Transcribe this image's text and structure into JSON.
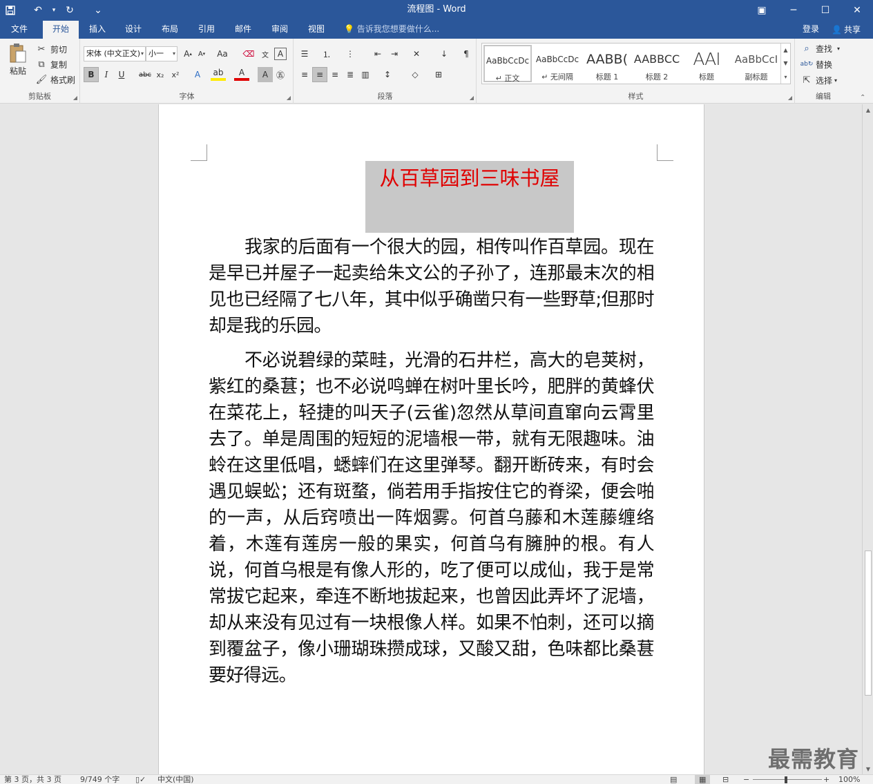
{
  "window": {
    "title": "流程图 - Word",
    "quick_access": {
      "more": "⌄"
    },
    "controls": {
      "ribbon_options": "▣",
      "minimize": "─",
      "maximize": "☐",
      "close": "✕"
    }
  },
  "tabs": [
    {
      "label": "文件",
      "active": false
    },
    {
      "label": "开始",
      "active": true
    },
    {
      "label": "插入",
      "active": false
    },
    {
      "label": "设计",
      "active": false
    },
    {
      "label": "布局",
      "active": false
    },
    {
      "label": "引用",
      "active": false
    },
    {
      "label": "邮件",
      "active": false
    },
    {
      "label": "审阅",
      "active": false
    },
    {
      "label": "视图",
      "active": false
    }
  ],
  "tell_me": "告诉我您想要做什么...",
  "account": {
    "login": "登录",
    "share": "共享"
  },
  "ribbon": {
    "clipboard": {
      "label": "剪贴板",
      "paste": "粘贴",
      "cut": "剪切",
      "copy": "复制",
      "format_painter": "格式刷"
    },
    "font": {
      "label": "字体",
      "font_name": "宋体 (中文正文)",
      "font_size": "小一"
    },
    "paragraph": {
      "label": "段落"
    },
    "styles": {
      "label": "样式",
      "items": [
        {
          "sample": "AaBbCcDc",
          "name": "↵ 正文"
        },
        {
          "sample": "AaBbCcDc",
          "name": "↵ 无间隔"
        },
        {
          "sample": "AABB(",
          "name": "标题 1"
        },
        {
          "sample": "AABBCC",
          "name": "标题 2"
        },
        {
          "sample": "AAI",
          "name": "标题"
        },
        {
          "sample": "AaBbCcI",
          "name": "副标题"
        }
      ]
    },
    "editing": {
      "label": "编辑",
      "find": "查找",
      "replace": "替换",
      "select": "选择"
    }
  },
  "document": {
    "title": "从百草园到三味书屋",
    "paragraphs": [
      "我家的后面有一个很大的园，相传叫作百草园。现在是早已并屋子一起卖给朱文公的子孙了，连那最末次的相见也已经隔了七八年，其中似乎确凿只有一些野草;但那时却是我的乐园。",
      "不必说碧绿的菜畦，光滑的石井栏，高大的皂荚树，紫红的桑葚；也不必说鸣蝉在树叶里长吟，肥胖的黄蜂伏在菜花上，轻捷的叫天子(云雀)忽然从草间直窜向云霄里去了。单是周围的短短的泥墙根一带，就有无限趣味。油蛉在这里低唱，蟋蟀们在这里弹琴。翻开断砖来，有时会遇见蜈蚣；还有斑蝥，倘若用手指按住它的脊梁，便会啪的一声，从后窍喷出一阵烟雾。何首乌藤和木莲藤缠络着，木莲有莲房一般的果实，何首乌有臃肿的根。有人说，何首乌根是有像人形的，吃了便可以成仙，我于是常常拔它起来，牵连不断地拔起来，也曾因此弄坏了泥墙，却从来没有见过有一块根像人样。如果不怕刺，还可以摘到覆盆子，像小珊瑚珠攒成球，又酸又甜，色味都比桑葚要好得远。"
    ]
  },
  "status": {
    "page": "第 3 页，共 3 页",
    "words": "9/749 个字",
    "language": "中文(中国)",
    "zoom": "100%"
  },
  "watermark": "最需教育",
  "colors": {
    "accent": "#2b579a",
    "title_red": "#e00000"
  }
}
